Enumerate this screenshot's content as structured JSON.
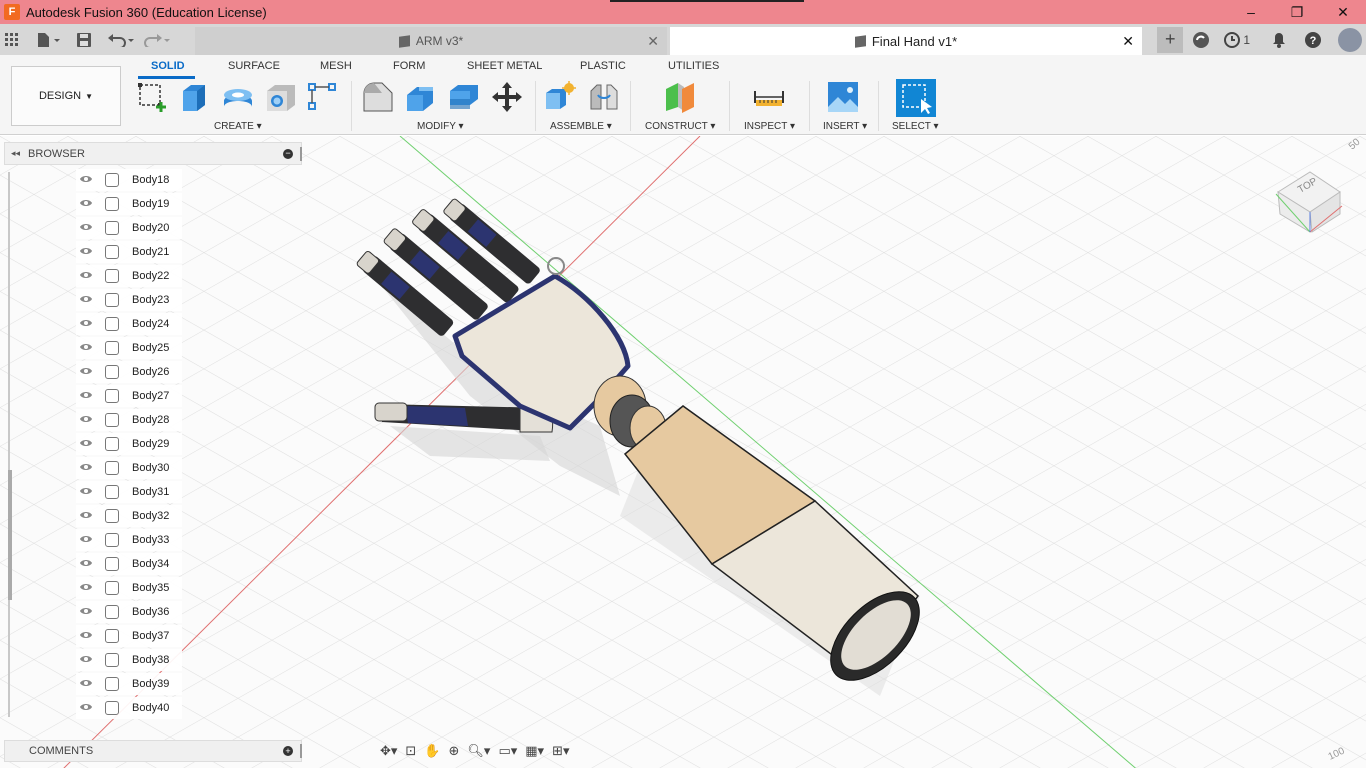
{
  "window": {
    "title": "Autodesk Fusion 360 (Education License)",
    "logo_letter": "F",
    "minimize": "–",
    "maximize": "❐",
    "close": "✕"
  },
  "tabs": {
    "inactive": {
      "label": "ARM v3*",
      "close": "✕"
    },
    "active": {
      "label": "Final Hand v1*",
      "close": "✕"
    }
  },
  "header_right": {
    "plus": "+",
    "job_count": "1"
  },
  "toolbar": {
    "workspace": "DESIGN",
    "tabs": [
      "SOLID",
      "SURFACE",
      "MESH",
      "FORM",
      "SHEET METAL",
      "PLASTIC",
      "UTILITIES"
    ],
    "groups": {
      "create": "CREATE",
      "modify": "MODIFY",
      "assemble": "ASSEMBLE",
      "construct": "CONSTRUCT",
      "inspect": "INSPECT",
      "insert": "INSERT",
      "select": "SELECT"
    }
  },
  "browser": {
    "title": "BROWSER",
    "bodies": [
      "Body18",
      "Body19",
      "Body20",
      "Body21",
      "Body22",
      "Body23",
      "Body24",
      "Body25",
      "Body26",
      "Body27",
      "Body28",
      "Body29",
      "Body30",
      "Body31",
      "Body32",
      "Body33",
      "Body34",
      "Body35",
      "Body36",
      "Body37",
      "Body38",
      "Body39",
      "Body40"
    ]
  },
  "comments": {
    "title": "COMMENTS"
  },
  "viewcube": {
    "face_label": "TOP"
  },
  "viewport": {
    "scale_top": "50",
    "scale_bottom": "100"
  },
  "colors": {
    "titlebar": "#ee868e",
    "accent": "#0a6bc7",
    "x_axis": "#e07070",
    "y_axis": "#70d070",
    "skin": "#e6c9a0",
    "shell": "#ece6da",
    "finger_dark": "#2e2e30",
    "finger_blue": "#2c3470"
  }
}
